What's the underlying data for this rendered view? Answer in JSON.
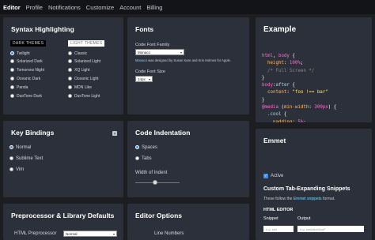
{
  "nav": {
    "items": [
      "Editor",
      "Profile",
      "Notifications",
      "Customize",
      "Account",
      "Billing"
    ],
    "active_index": 0
  },
  "syntax": {
    "title": "Syntax Highlighting",
    "dark_header": "DARK THEMES",
    "light_header": "LIGHT THEMES",
    "dark_themes": [
      "Twilight",
      "Solarized Dark",
      "Tomorrow Night",
      "Oceanic Dark",
      "Panda",
      "DuoTone Dark"
    ],
    "light_themes": [
      "Classic",
      "Solarized Light",
      "XQ Light",
      "Oceanic Light",
      "MDN Like",
      "DuoTone Light"
    ],
    "selected": "Twilight"
  },
  "fonts": {
    "title": "Fonts",
    "family_label": "Code Font Family",
    "family_value": "Monaco",
    "designer_font": "Monaco",
    "designer_note": " was designed by Susan Kare and Kris Holmes for Apple.",
    "size_label": "Code Font Size",
    "size_value": "14px"
  },
  "example": {
    "title": "Example"
  },
  "keybindings": {
    "title": "Key Bindings",
    "help": "?",
    "options": [
      "Normal",
      "Sublime Text",
      "Vim"
    ],
    "selected": "Normal"
  },
  "indent": {
    "title": "Code Indentation",
    "options": [
      "Spaces",
      "Tabs"
    ],
    "selected": "Spaces",
    "width_label": "Width of Indent",
    "width_level": 0.45
  },
  "emmet": {
    "title": "Emmet",
    "active_label": "Active",
    "active_checked": true,
    "snippets_title": "Custom Tab-Expanding Snippets",
    "snippets_desc_pre": "These follow the ",
    "snippets_desc_link": "Emmet snippets",
    "snippets_desc_post": " format.",
    "html_editor_label": "HTML EDITOR",
    "col_snippet": "Snippet",
    "col_output": "Output",
    "snippet_placeholder": "e.g. see",
    "output_placeholder": "e.g. see|alive|tooF"
  },
  "preprocessor": {
    "title": "Preprocessor & Library Defaults",
    "html_label": "HTML Preprocessor",
    "html_value": "Normal"
  },
  "editor_options": {
    "title": "Editor Options",
    "line_numbers_label": "Line Numbers"
  },
  "colors": {
    "background": "#1d1e22",
    "panel": "#2c303a",
    "accent_blue": "#3c8ee6",
    "code_pink": "#ff6bd4",
    "code_orange": "#ffb86b"
  }
}
